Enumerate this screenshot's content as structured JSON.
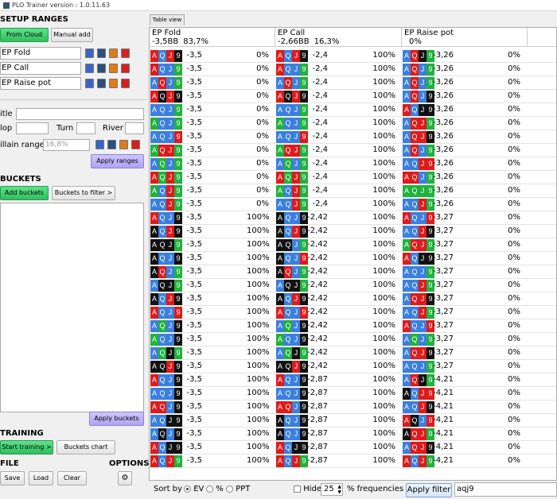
{
  "window_title": "PLO Trainer version : 1.0.11.63",
  "left": {
    "setup_title": "SETUP RANGES",
    "from_cloud": "From Cloud",
    "manual_add": "Manual add",
    "ranges": [
      "EP Fold",
      "EP Call",
      "EP Raise pot"
    ],
    "title_label": "itle",
    "flop_label": "lop",
    "turn_label": "Turn",
    "river_label": "River",
    "villain_label": "illain range",
    "villain_placeholder": "16,8%",
    "apply_ranges": "Apply ranges",
    "buckets_title": "BUCKETS",
    "add_buckets": "Add buckets",
    "buckets_to_filter": "Buckets to filter >",
    "apply_buckets": "Apply buckets",
    "training_title": "TRAINING",
    "start_training": "Start training >",
    "buckets_chart": "Buckets chart",
    "file_title": "FILE",
    "options_title": "OPTIONS",
    "save": "Save",
    "load": "Load",
    "clear": "Clear"
  },
  "table": {
    "tab": "Table view",
    "columns": [
      {
        "name": "EP Fold",
        "ev": "-3,5BB",
        "freq": "83,7%"
      },
      {
        "name": "EP Call",
        "ev": "-2,66BB",
        "freq": "16,3%"
      },
      {
        "name": "EP Raise pot",
        "ev": "",
        "freq": "0%"
      }
    ],
    "rows": [
      {
        "h": [
          [
            "r",
            "b",
            "r",
            "k"
          ],
          [
            "r",
            "b",
            "r",
            "k"
          ],
          [
            "b",
            "r",
            "k",
            "g"
          ]
        ],
        "v": [
          "-3,5",
          "0%",
          "-2,4",
          "100%",
          "-3,26",
          "0%"
        ]
      },
      {
        "h": [
          [
            "r",
            "b",
            "b",
            "g"
          ],
          [
            "r",
            "b",
            "b",
            "g"
          ],
          [
            "b",
            "r",
            "b",
            "g"
          ]
        ],
        "v": [
          "-3,5",
          "0%",
          "-2,4",
          "100%",
          "-3,26",
          "0%"
        ]
      },
      {
        "h": [
          [
            "b",
            "r",
            "b",
            "g"
          ],
          [
            "b",
            "r",
            "b",
            "g"
          ],
          [
            "b",
            "r",
            "b",
            "g"
          ]
        ],
        "v": [
          "-3,5",
          "0%",
          "-2,4",
          "100%",
          "-3,26",
          "0%"
        ]
      },
      {
        "h": [
          [
            "r",
            "k",
            "r",
            "k"
          ],
          [
            "r",
            "k",
            "r",
            "k"
          ],
          [
            "b",
            "r",
            "b",
            "k"
          ]
        ],
        "v": [
          "-3,5",
          "0%",
          "-2,4",
          "100%",
          "-3,26",
          "0%"
        ]
      },
      {
        "h": [
          [
            "b",
            "b",
            "b",
            "g"
          ],
          [
            "b",
            "b",
            "b",
            "g"
          ],
          [
            "r",
            "b",
            "k",
            "k"
          ]
        ],
        "v": [
          "-3,5",
          "0%",
          "-2,4",
          "100%",
          "-3,26",
          "0%"
        ]
      },
      {
        "h": [
          [
            "g",
            "b",
            "b",
            "g"
          ],
          [
            "g",
            "b",
            "b",
            "g"
          ],
          [
            "b",
            "r",
            "r",
            "g"
          ]
        ],
        "v": [
          "-3,5",
          "0%",
          "-2,4",
          "100%",
          "-3,26",
          "0%"
        ]
      },
      {
        "h": [
          [
            "b",
            "b",
            "b",
            "r"
          ],
          [
            "b",
            "b",
            "b",
            "r"
          ],
          [
            "b",
            "r",
            "r",
            "k"
          ]
        ],
        "v": [
          "-3,5",
          "0%",
          "-2,4",
          "100%",
          "-3,26",
          "0%"
        ]
      },
      {
        "h": [
          [
            "g",
            "r",
            "r",
            "g"
          ],
          [
            "g",
            "r",
            "r",
            "g"
          ],
          [
            "b",
            "r",
            "b",
            "g"
          ]
        ],
        "v": [
          "-3,5",
          "0%",
          "-2,4",
          "100%",
          "-3,26",
          "0%"
        ]
      },
      {
        "h": [
          [
            "b",
            "g",
            "b",
            "g"
          ],
          [
            "b",
            "g",
            "b",
            "g"
          ],
          [
            "b",
            "b",
            "r",
            "r"
          ]
        ],
        "v": [
          "-3,5",
          "0%",
          "-2,4",
          "100%",
          "-3,26",
          "0%"
        ]
      },
      {
        "h": [
          [
            "r",
            "g",
            "r",
            "g"
          ],
          [
            "r",
            "g",
            "r",
            "g"
          ],
          [
            "r",
            "r",
            "b",
            "g"
          ]
        ],
        "v": [
          "-3,5",
          "0%",
          "-2,4",
          "100%",
          "-3,26",
          "0%"
        ]
      },
      {
        "h": [
          [
            "g",
            "b",
            "r",
            "g"
          ],
          [
            "g",
            "b",
            "r",
            "g"
          ],
          [
            "g",
            "g",
            "g",
            "g"
          ]
        ],
        "v": [
          "-3,5",
          "0%",
          "-2,4",
          "100%",
          "-3,26",
          "0%"
        ]
      },
      {
        "h": [
          [
            "b",
            "b",
            "r",
            "g"
          ],
          [
            "b",
            "b",
            "r",
            "g"
          ],
          [
            "b",
            "b",
            "r",
            "g"
          ]
        ],
        "v": [
          "-3,5",
          "0%",
          "-2,4",
          "100%",
          "-3,26",
          "0%"
        ]
      },
      {
        "h": [
          [
            "r",
            "b",
            "b",
            "k"
          ],
          [
            "k",
            "b",
            "b",
            "k"
          ],
          [
            "r",
            "b",
            "b",
            "r"
          ]
        ],
        "v": [
          "-3,5",
          "100%",
          "-2,42",
          "100%",
          "-3,27",
          "0%"
        ]
      },
      {
        "h": [
          [
            "k",
            "b",
            "r",
            "k"
          ],
          [
            "k",
            "b",
            "r",
            "k"
          ],
          [
            "b",
            "b",
            "r",
            "k"
          ]
        ],
        "v": [
          "-3,5",
          "100%",
          "-2,42",
          "100%",
          "-3,27",
          "0%"
        ]
      },
      {
        "h": [
          [
            "k",
            "k",
            "k",
            "g"
          ],
          [
            "k",
            "k",
            "b",
            "g"
          ],
          [
            "g",
            "r",
            "r",
            "g"
          ]
        ],
        "v": [
          "-3,5",
          "100%",
          "-2,42",
          "100%",
          "-3,27",
          "0%"
        ]
      },
      {
        "h": [
          [
            "k",
            "b",
            "b",
            "k"
          ],
          [
            "k",
            "b",
            "b",
            "r"
          ],
          [
            "r",
            "b",
            "k",
            "k"
          ]
        ],
        "v": [
          "-3,5",
          "100%",
          "-2,42",
          "100%",
          "-3,27",
          "0%"
        ]
      },
      {
        "h": [
          [
            "k",
            "r",
            "b",
            "g"
          ],
          [
            "k",
            "r",
            "b",
            "g"
          ],
          [
            "b",
            "b",
            "b",
            "g"
          ]
        ],
        "v": [
          "-3,5",
          "100%",
          "-2,42",
          "100%",
          "-3,27",
          "0%"
        ]
      },
      {
        "h": [
          [
            "b",
            "k",
            "k",
            "g"
          ],
          [
            "b",
            "k",
            "k",
            "g"
          ],
          [
            "b",
            "b",
            "r",
            "g"
          ]
        ],
        "v": [
          "-3,5",
          "100%",
          "-2,42",
          "100%",
          "-3,27",
          "0%"
        ]
      },
      {
        "h": [
          [
            "k",
            "b",
            "r",
            "k"
          ],
          [
            "k",
            "b",
            "r",
            "k"
          ],
          [
            "b",
            "r",
            "r",
            "k"
          ]
        ],
        "v": [
          "-3,5",
          "100%",
          "-2,42",
          "100%",
          "-3,27",
          "0%"
        ]
      },
      {
        "h": [
          [
            "r",
            "b",
            "b",
            "r"
          ],
          [
            "r",
            "b",
            "b",
            "r"
          ],
          [
            "b",
            "b",
            "r",
            "g"
          ]
        ],
        "v": [
          "-3,5",
          "100%",
          "-2,42",
          "100%",
          "-3,27",
          "0%"
        ]
      },
      {
        "h": [
          [
            "b",
            "g",
            "b",
            "k"
          ],
          [
            "b",
            "g",
            "b",
            "k"
          ],
          [
            "r",
            "b",
            "b",
            "r"
          ]
        ],
        "v": [
          "-3,5",
          "100%",
          "-2,42",
          "100%",
          "-3,27",
          "0%"
        ]
      },
      {
        "h": [
          [
            "g",
            "b",
            "b",
            "k"
          ],
          [
            "g",
            "b",
            "b",
            "k"
          ],
          [
            "b",
            "g",
            "b",
            "g"
          ]
        ],
        "v": [
          "-3,5",
          "100%",
          "-2,42",
          "100%",
          "-3,27",
          "0%"
        ]
      },
      {
        "h": [
          [
            "b",
            "g",
            "k",
            "g"
          ],
          [
            "b",
            "g",
            "k",
            "g"
          ],
          [
            "b",
            "r",
            "r",
            "k"
          ]
        ],
        "v": [
          "-3,5",
          "100%",
          "-2,42",
          "100%",
          "-3,27",
          "0%"
        ]
      },
      {
        "h": [
          [
            "k",
            "k",
            "r",
            "k"
          ],
          [
            "k",
            "k",
            "r",
            "k"
          ],
          [
            "b",
            "b",
            "b",
            "g"
          ]
        ],
        "v": [
          "-3,5",
          "100%",
          "-2,42",
          "100%",
          "-3,27",
          "0%"
        ]
      },
      {
        "h": [
          [
            "r",
            "b",
            "b",
            "k"
          ],
          [
            "r",
            "b",
            "b",
            "k"
          ],
          [
            "b",
            "r",
            "k",
            "g"
          ]
        ],
        "v": [
          "-3,5",
          "100%",
          "-2,87",
          "100%",
          "-4,21",
          "0%"
        ]
      },
      {
        "h": [
          [
            "b",
            "b",
            "b",
            "k"
          ],
          [
            "b",
            "b",
            "b",
            "k"
          ],
          [
            "k",
            "b",
            "r",
            "r"
          ]
        ],
        "v": [
          "-3,5",
          "100%",
          "-2,87",
          "100%",
          "-4,21",
          "0%"
        ]
      },
      {
        "h": [
          [
            "r",
            "r",
            "b",
            "k"
          ],
          [
            "r",
            "r",
            "b",
            "k"
          ],
          [
            "b",
            "b",
            "r",
            "k"
          ]
        ],
        "v": [
          "-3,5",
          "100%",
          "-2,87",
          "100%",
          "-4,21",
          "0%"
        ]
      },
      {
        "h": [
          [
            "b",
            "b",
            "k",
            "k"
          ],
          [
            "k",
            "b",
            "b",
            "k"
          ],
          [
            "r",
            "k",
            "b",
            "r"
          ]
        ],
        "v": [
          "-3,5",
          "100%",
          "-2,87",
          "100%",
          "-4,21",
          "0%"
        ]
      },
      {
        "h": [
          [
            "b",
            "k",
            "b",
            "k"
          ],
          [
            "k",
            "b",
            "b",
            "k"
          ],
          [
            "k",
            "r",
            "r",
            "g"
          ]
        ],
        "v": [
          "-3,5",
          "100%",
          "-2,87",
          "100%",
          "-4,21",
          "0%"
        ]
      },
      {
        "h": [
          [
            "r",
            "b",
            "k",
            "k"
          ],
          [
            "r",
            "b",
            "k",
            "k"
          ],
          [
            "b",
            "r",
            "r",
            "k"
          ]
        ],
        "v": [
          "-3,5",
          "100%",
          "-2,87",
          "100%",
          "-4,21",
          "0%"
        ]
      },
      {
        "h": [
          [
            "r",
            "b",
            "r",
            "g"
          ],
          [
            "r",
            "b",
            "r",
            "g"
          ],
          [
            "r",
            "b",
            "r",
            "g"
          ]
        ],
        "v": [
          "-3,5",
          "100%",
          "-2,87",
          "100%",
          "-4,21",
          "0%"
        ]
      }
    ],
    "hand": [
      "A",
      "Q",
      "J",
      "9"
    ]
  },
  "bottom": {
    "sort_by": "Sort by",
    "ev": "EV",
    "pct": "%",
    "ppt": "PPT",
    "hide": "Hide",
    "freq_value": "25",
    "freq_label": "% frequencies",
    "apply_filter": "Apply filter",
    "filter_value": "aqj9"
  }
}
